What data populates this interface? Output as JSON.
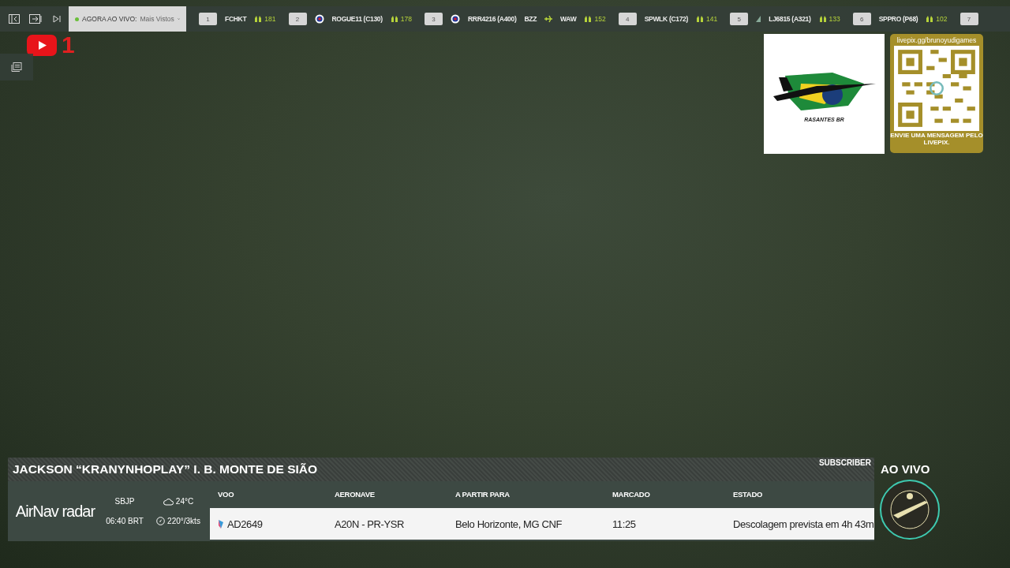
{
  "top_bar": {
    "live_label": "AGORA AO VIVO:",
    "live_value": "Mais Vistos",
    "ranking": [
      {
        "rank": "1",
        "callsign": "FCHKT",
        "flag": false,
        "viewers": "181"
      },
      {
        "rank": "2",
        "callsign": "ROGUE11 (C130)",
        "flag": true,
        "viewers": "178"
      },
      {
        "rank": "3",
        "callsign": "RRR4216 (A400)",
        "flag": true,
        "route_from": "BZZ",
        "route_to": "WAW",
        "viewers": "152"
      },
      {
        "rank": "4",
        "callsign": "SPWLK (C172)",
        "flag": false,
        "viewers": "141"
      },
      {
        "rank": "5",
        "callsign": "LJ6815 (A321)",
        "flag": false,
        "airline_mark": true,
        "viewers": "133"
      },
      {
        "rank": "6",
        "callsign": "SPPRO (P68)",
        "flag": false,
        "viewers": "102"
      },
      {
        "rank": "7"
      }
    ]
  },
  "notification_count": "1",
  "sponsor": {
    "name": "RASANTES BR"
  },
  "livepix": {
    "url": "livepix.gg/brunoyudigames",
    "caption": "ENVIE UMA MENSAGEM PELO LIVEPIX."
  },
  "panel": {
    "title": "JACKSON “KRANYNHOPLAY” I. B. MONTE DE SIÃO",
    "tag": "SUBSCRIBER",
    "brand": "**AirNav** radar",
    "airport": "SBJP",
    "time": "06:40 BRT",
    "temperature": "24°C",
    "wind": "220°/3kts",
    "table": {
      "columns": [
        "VOO",
        "AERONAVE",
        "A PARTIR PARA",
        "MARCADO",
        "ESTADO"
      ],
      "rows": [
        [
          "AD2649",
          "A20N - PR-YSR",
          "Belo Horizonte, MG CNF",
          "11:25",
          "Descolagem prevista em 4h 43m"
        ]
      ]
    }
  },
  "live_badge": "AO VIVO"
}
